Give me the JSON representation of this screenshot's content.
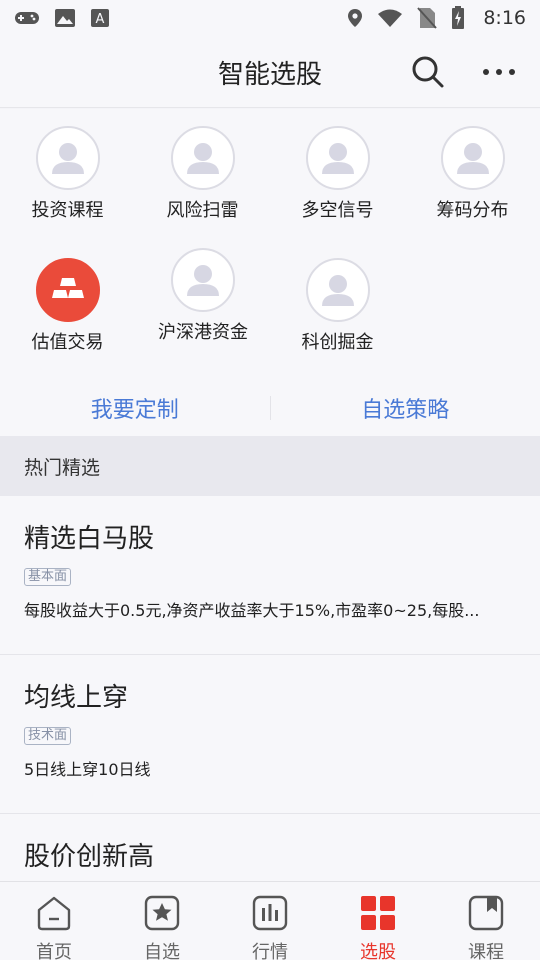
{
  "status": {
    "time": "8:16"
  },
  "header": {
    "title": "智能选股"
  },
  "grid": {
    "items": [
      {
        "label": "投资课程",
        "icon": "avatar-icon"
      },
      {
        "label": "风险扫雷",
        "icon": "avatar-icon"
      },
      {
        "label": "多空信号",
        "icon": "avatar-icon"
      },
      {
        "label": "筹码分布",
        "icon": "avatar-icon"
      },
      {
        "label": "估值交易",
        "icon": "gold-bars-icon"
      },
      {
        "label": "沪深港资金",
        "icon": "avatar-icon"
      },
      {
        "label": "科创掘金",
        "icon": "avatar-icon"
      }
    ]
  },
  "links": {
    "custom": "我要定制",
    "strategy": "自选策略"
  },
  "section": {
    "title": "热门精选"
  },
  "cards": [
    {
      "title": "精选白马股",
      "tag": "基本面",
      "desc": "每股收益大于0.5元,净资产收益率大于15%,市盈率0~25,每股..."
    },
    {
      "title": "均线上穿",
      "tag": "技术面",
      "desc": "5日线上穿10日线"
    },
    {
      "title": "股价创新高"
    }
  ],
  "tabs": [
    {
      "label": "首页",
      "icon": "home-icon"
    },
    {
      "label": "自选",
      "icon": "star-icon"
    },
    {
      "label": "行情",
      "icon": "chart-icon"
    },
    {
      "label": "选股",
      "icon": "grid-icon"
    },
    {
      "label": "课程",
      "icon": "book-icon"
    }
  ],
  "colors": {
    "accent": "#e8352b",
    "link": "#4a7ad6",
    "red_icon": "#ea4b3a"
  }
}
